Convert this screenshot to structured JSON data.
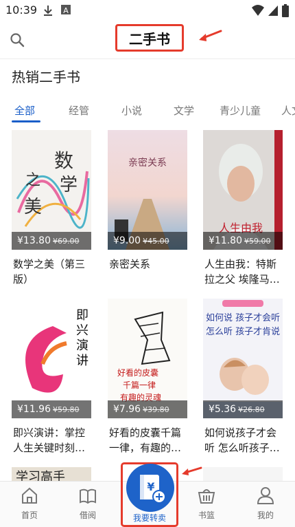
{
  "status": {
    "time": "10:39"
  },
  "header": {
    "title": "二手书"
  },
  "section": {
    "title": "热销二手书"
  },
  "tabs": [
    {
      "label": "全部"
    },
    {
      "label": "经管"
    },
    {
      "label": "小说"
    },
    {
      "label": "文学"
    },
    {
      "label": "青少儿童"
    },
    {
      "label": "人文"
    }
  ],
  "books": [
    {
      "title": "数学之美（第三版）",
      "price": "¥13.80",
      "old": "¥69.00",
      "cover_text": "数学之美",
      "cover_bg": "#f4f2ef"
    },
    {
      "title": "亲密关系",
      "price": "¥9.00",
      "old": "¥45.00",
      "cover_text": "亲密关系",
      "cover_bg": "#e9d7df"
    },
    {
      "title": "人生由我：特斯拉之父 埃隆马…",
      "price": "¥11.80",
      "old": "¥59.00",
      "cover_text": "人生由我",
      "cover_bg": "#e7e3e1"
    },
    {
      "title": "即兴演讲：掌控人生关键时刻…",
      "price": "¥11.96",
      "old": "¥59.80",
      "cover_text": "即兴演讲",
      "cover_bg": "#ffffff"
    },
    {
      "title": "好看的皮囊千篇一律，有趣的…",
      "price": "¥7.96",
      "old": "¥39.80",
      "cover_text": "好看的皮囊",
      "cover_bg": "#fbfaf7"
    },
    {
      "title": "如何说孩子才会听 怎么听孩子…",
      "price": "¥5.36",
      "old": "¥26.80",
      "cover_text": "如何说 孩子才会听",
      "cover_bg": "#f4f4f8"
    }
  ],
  "nav": [
    {
      "label": "首页"
    },
    {
      "label": "借阅"
    },
    {
      "label": "我要转卖"
    },
    {
      "label": "书篮"
    },
    {
      "label": "我的"
    }
  ],
  "colors": {
    "accent": "#1a5ec8",
    "highlight": "#e53b2c"
  }
}
